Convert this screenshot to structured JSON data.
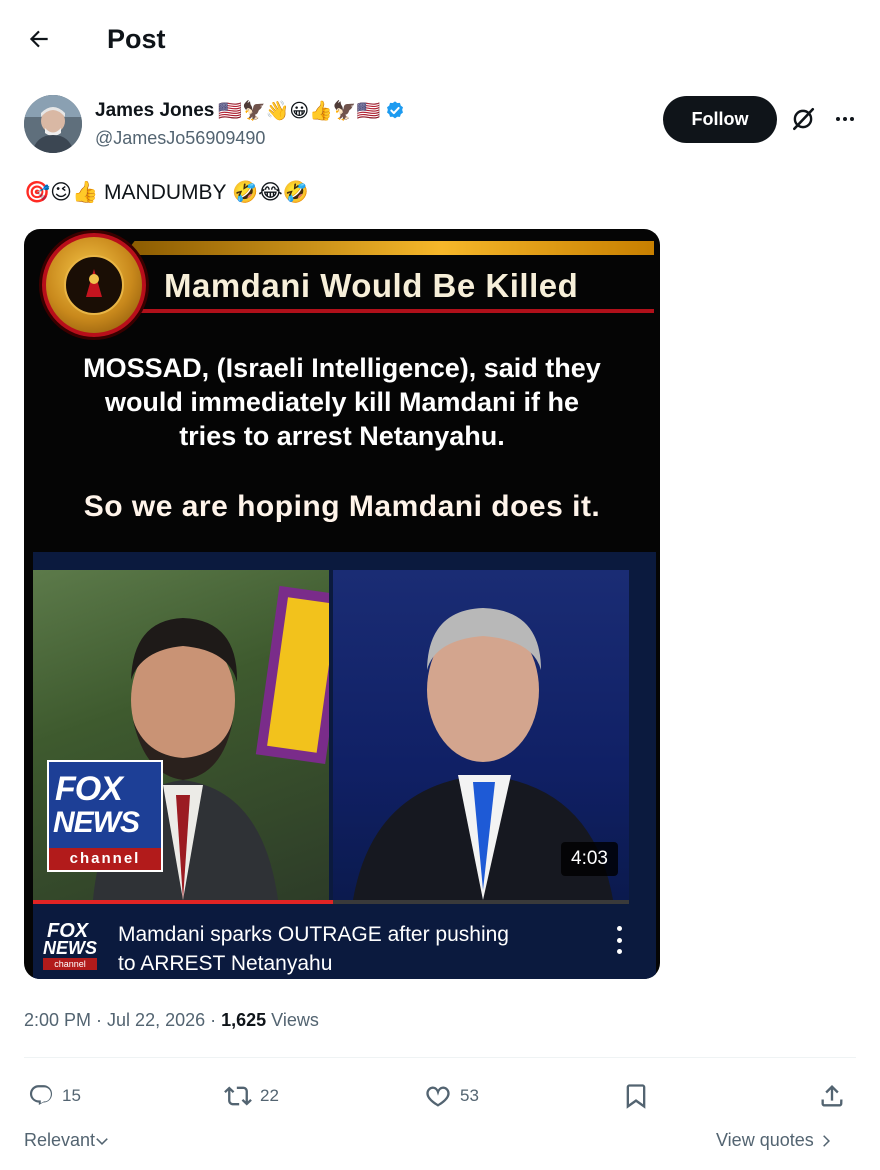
{
  "header": {
    "title": "Post"
  },
  "author": {
    "display_name": "James Jones",
    "name_emojis": "🇺🇸🦅👋😀👍🦅🇺🇸",
    "handle": "@JamesJo56909490",
    "follow_label": "Follow"
  },
  "post": {
    "emoji_prefix": "🎯😉👍",
    "text": "MANDUMBY",
    "emoji_suffix": "🤣😂🤣"
  },
  "media": {
    "banner_title": "Mamdani Would Be Killed",
    "quote_line1": "MOSSAD, (Israeli Intelligence), said they",
    "quote_line2": "would immediately kill Mamdani if he",
    "quote_line3": "tries to arrest Netanyahu.",
    "quote_line4": "So we are hoping Mamdani does it.",
    "video": {
      "logo_line1": "FOX",
      "logo_line2": "NEWS",
      "logo_line3": "channel",
      "duration": "4:03",
      "title_line1": "Mamdani sparks OUTRAGE after pushing",
      "title_line2": "to ARREST Netanyahu"
    }
  },
  "meta": {
    "time": "2:00 PM",
    "sep1": " · ",
    "date": "Jul 22, 2026",
    "sep2": " · ",
    "views_count": "1,625",
    "views_label": " Views"
  },
  "actions": {
    "replies": "15",
    "reposts": "22",
    "likes": "53"
  },
  "footer": {
    "sort_label": "Relevant",
    "quotes_label": "View quotes"
  },
  "colors": {
    "text_primary": "#0f1419",
    "text_secondary": "#536471",
    "verified_blue": "#1d9bf0",
    "follow_bg": "#0f1419"
  }
}
